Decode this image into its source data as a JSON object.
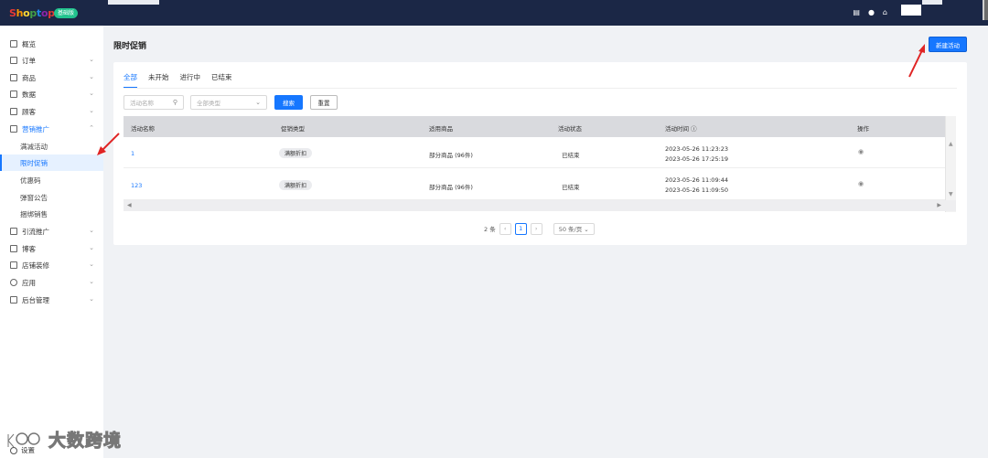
{
  "app": {
    "logo_letters": [
      "S",
      "h",
      "o",
      "p",
      "t",
      "o",
      "p"
    ],
    "logo_colors": [
      "#e53935",
      "#ff9800",
      "#fdd835",
      "#43a047",
      "#1e88e5",
      "#8e24aa",
      "#e53935"
    ],
    "version_badge": "基础版"
  },
  "topbar": {
    "icons": [
      "database-icon",
      "help-icon",
      "home-icon"
    ],
    "icon_glyphs": [
      "▤",
      "●",
      "⌂"
    ]
  },
  "sidebar": {
    "items": [
      {
        "label": "概览",
        "chevron": ""
      },
      {
        "label": "订单",
        "chevron": "⌄"
      },
      {
        "label": "商品",
        "chevron": "⌄"
      },
      {
        "label": "数据",
        "chevron": "⌄"
      },
      {
        "label": "顾客",
        "chevron": "⌄"
      },
      {
        "label": "营销推广",
        "chevron": "⌃"
      },
      {
        "label": "满减活动",
        "chevron": ""
      },
      {
        "label": "限时促销",
        "chevron": ""
      },
      {
        "label": "优惠码",
        "chevron": ""
      },
      {
        "label": "弹窗公告",
        "chevron": ""
      },
      {
        "label": "捆绑销售",
        "chevron": ""
      },
      {
        "label": "引流推广",
        "chevron": "⌄"
      },
      {
        "label": "博客",
        "chevron": "⌄"
      },
      {
        "label": "店铺装修",
        "chevron": "⌄"
      },
      {
        "label": "应用",
        "chevron": "⌄"
      },
      {
        "label": "后台管理",
        "chevron": "⌄"
      }
    ],
    "settings_label": "设置"
  },
  "main": {
    "page_title": "限时促销",
    "new_button": "新建活动",
    "tabs": [
      "全部",
      "未开始",
      "进行中",
      "已结束"
    ],
    "filters": {
      "name_placeholder": "活动名称",
      "type_placeholder": "全部类型",
      "search_label": "搜索",
      "reset_label": "重置"
    },
    "table": {
      "headers": [
        "活动名称",
        "促销类型",
        "适用商品",
        "活动状态",
        "活动时间 ⓘ",
        "操作"
      ],
      "rows": [
        {
          "name": "1",
          "type": "满额折扣",
          "products": "部分商品 (96件)",
          "status": "已结束",
          "start": "2023-05-26 11:23:23",
          "end": "2023-05-26 17:25:19"
        },
        {
          "name": "123",
          "type": "满额折扣",
          "products": "部分商品 (96件)",
          "status": "已结束",
          "start": "2023-05-26 11:09:44",
          "end": "2023-05-26 11:09:50"
        }
      ]
    },
    "pagination": {
      "total": "2 条",
      "prev": "‹",
      "current": "1",
      "next": "›",
      "page_size": "50 条/页 ⌄"
    }
  },
  "watermark": {
    "text": "大数跨境"
  }
}
